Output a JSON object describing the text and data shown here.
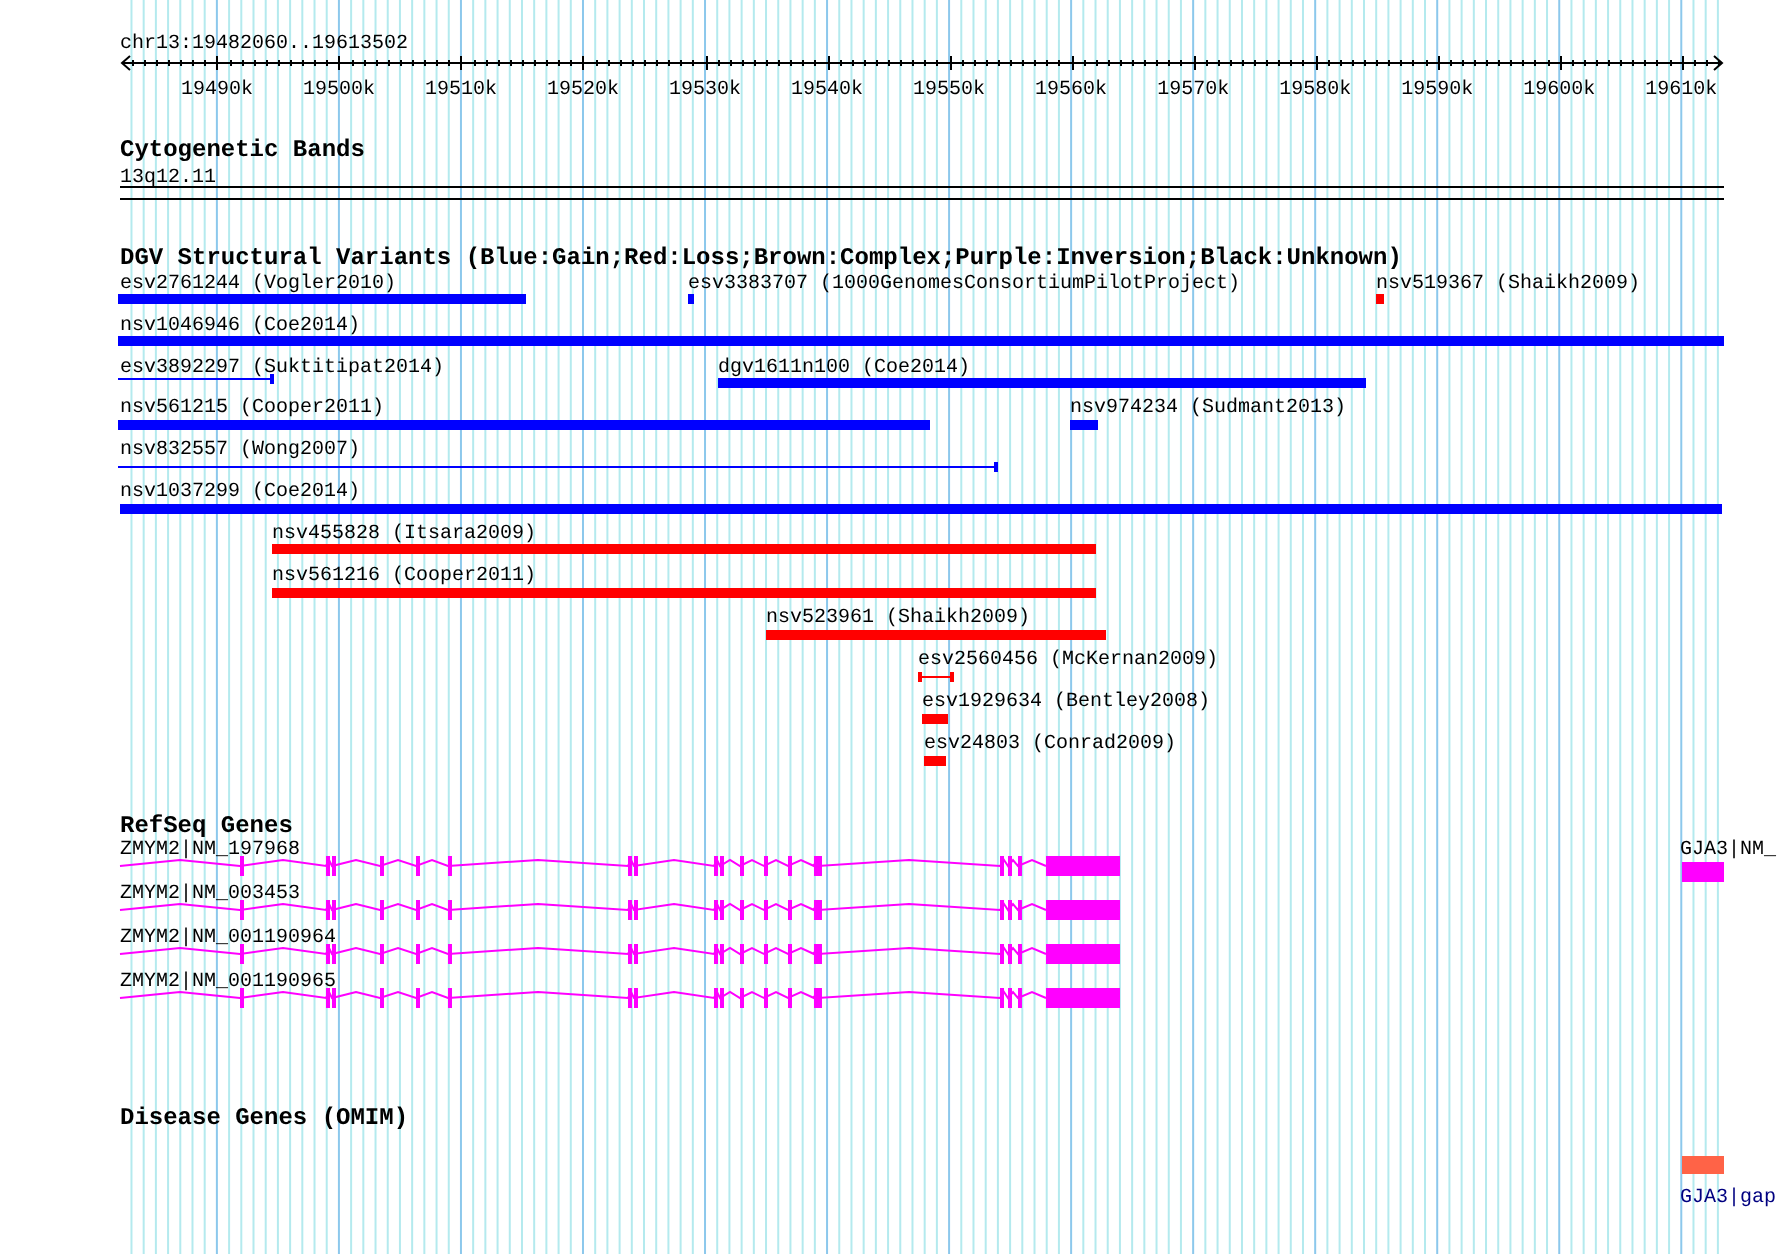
{
  "ruler": {
    "region": "chr13:19482060..19613502",
    "ticks": [
      "19490k",
      "19500k",
      "19510k",
      "19520k",
      "19530k",
      "19540k",
      "19550k",
      "19560k",
      "19570k",
      "19580k",
      "19590k",
      "19600k",
      "19610k"
    ]
  },
  "cytogenetic_bands": {
    "title": "Cytogenetic Bands",
    "band": "13q12.11"
  },
  "structural_variants": {
    "title": "DGV Structural Variants (Blue:Gain;Red:Loss;Brown:Complex;Purple:Inversion;Black:Unknown)",
    "variants": [
      {
        "label": "esv2761244 (Vogler2010)",
        "color": "#0000ff",
        "kind": "bar"
      },
      {
        "label": "esv3383707 (1000GenomesConsortiumPilotProject)",
        "color": "#0000ff",
        "kind": "bar"
      },
      {
        "label": "nsv519367 (Shaikh2009)",
        "color": "#ff0000",
        "kind": "bar"
      },
      {
        "label": "nsv1046946 (Coe2014)",
        "color": "#0000ff",
        "kind": "bar"
      },
      {
        "label": "esv3892297 (Suktitipat2014)",
        "color": "#0000ff",
        "kind": "line"
      },
      {
        "label": "dgv1611n100 (Coe2014)",
        "color": "#0000ff",
        "kind": "bar"
      },
      {
        "label": "nsv561215 (Cooper2011)",
        "color": "#0000ff",
        "kind": "bar"
      },
      {
        "label": "nsv974234 (Sudmant2013)",
        "color": "#0000ff",
        "kind": "bar"
      },
      {
        "label": "nsv832557 (Wong2007)",
        "color": "#0000ff",
        "kind": "line"
      },
      {
        "label": "nsv1037299 (Coe2014)",
        "color": "#0000ff",
        "kind": "bar"
      },
      {
        "label": "nsv455828 (Itsara2009)",
        "color": "#ff0000",
        "kind": "bar"
      },
      {
        "label": "nsv561216 (Cooper2011)",
        "color": "#ff0000",
        "kind": "bar"
      },
      {
        "label": "nsv523961 (Shaikh2009)",
        "color": "#ff0000",
        "kind": "bar"
      },
      {
        "label": "esv2560456 (McKernan2009)",
        "color": "#ff0000",
        "kind": "line"
      },
      {
        "label": "esv1929634 (Bentley2008)",
        "color": "#ff0000",
        "kind": "bar"
      },
      {
        "label": "esv24803 (Conrad2009)",
        "color": "#ff0000",
        "kind": "bar"
      }
    ]
  },
  "refseq_genes": {
    "title": "RefSeq Genes",
    "genes": [
      {
        "label": "ZMYM2|NM_197968",
        "kind": "multi_exon"
      },
      {
        "label": "ZMYM2|NM_003453",
        "kind": "multi_exon"
      },
      {
        "label": "ZMYM2|NM_001190964",
        "kind": "multi_exon"
      },
      {
        "label": "ZMYM2|NM_001190965",
        "kind": "multi_exon"
      },
      {
        "label": "GJA3|NM_",
        "kind": "single_block"
      }
    ]
  },
  "disease_genes": {
    "title": "Disease Genes (OMIM)",
    "features": [
      {
        "label": "GJA3|gap"
      }
    ]
  }
}
